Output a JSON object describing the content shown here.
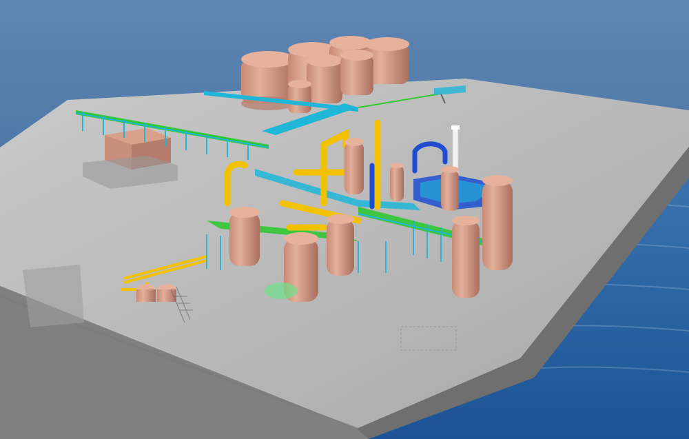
{
  "scene": {
    "subject": "3d-industrial-plant-model",
    "colors": {
      "sky_top": "#5f86b4",
      "sky_bottom": "#2f5f8f",
      "sea_top": "#3a74b0",
      "sea_bottom": "#1b5395",
      "deck_top": "#b6b6b6",
      "deck_side_front": "#7c7c7c",
      "deck_side_right": "#6a6a6a",
      "tank_fill": "#d9a08a",
      "tank_shade": "#b37a68",
      "pipe_yellow": "#f2c200",
      "pipe_cyan": "#1fb6d8",
      "pipe_blue": "#1f4fd0",
      "pipe_green": "#32c833",
      "stack_white": "#f2f2f2"
    }
  }
}
